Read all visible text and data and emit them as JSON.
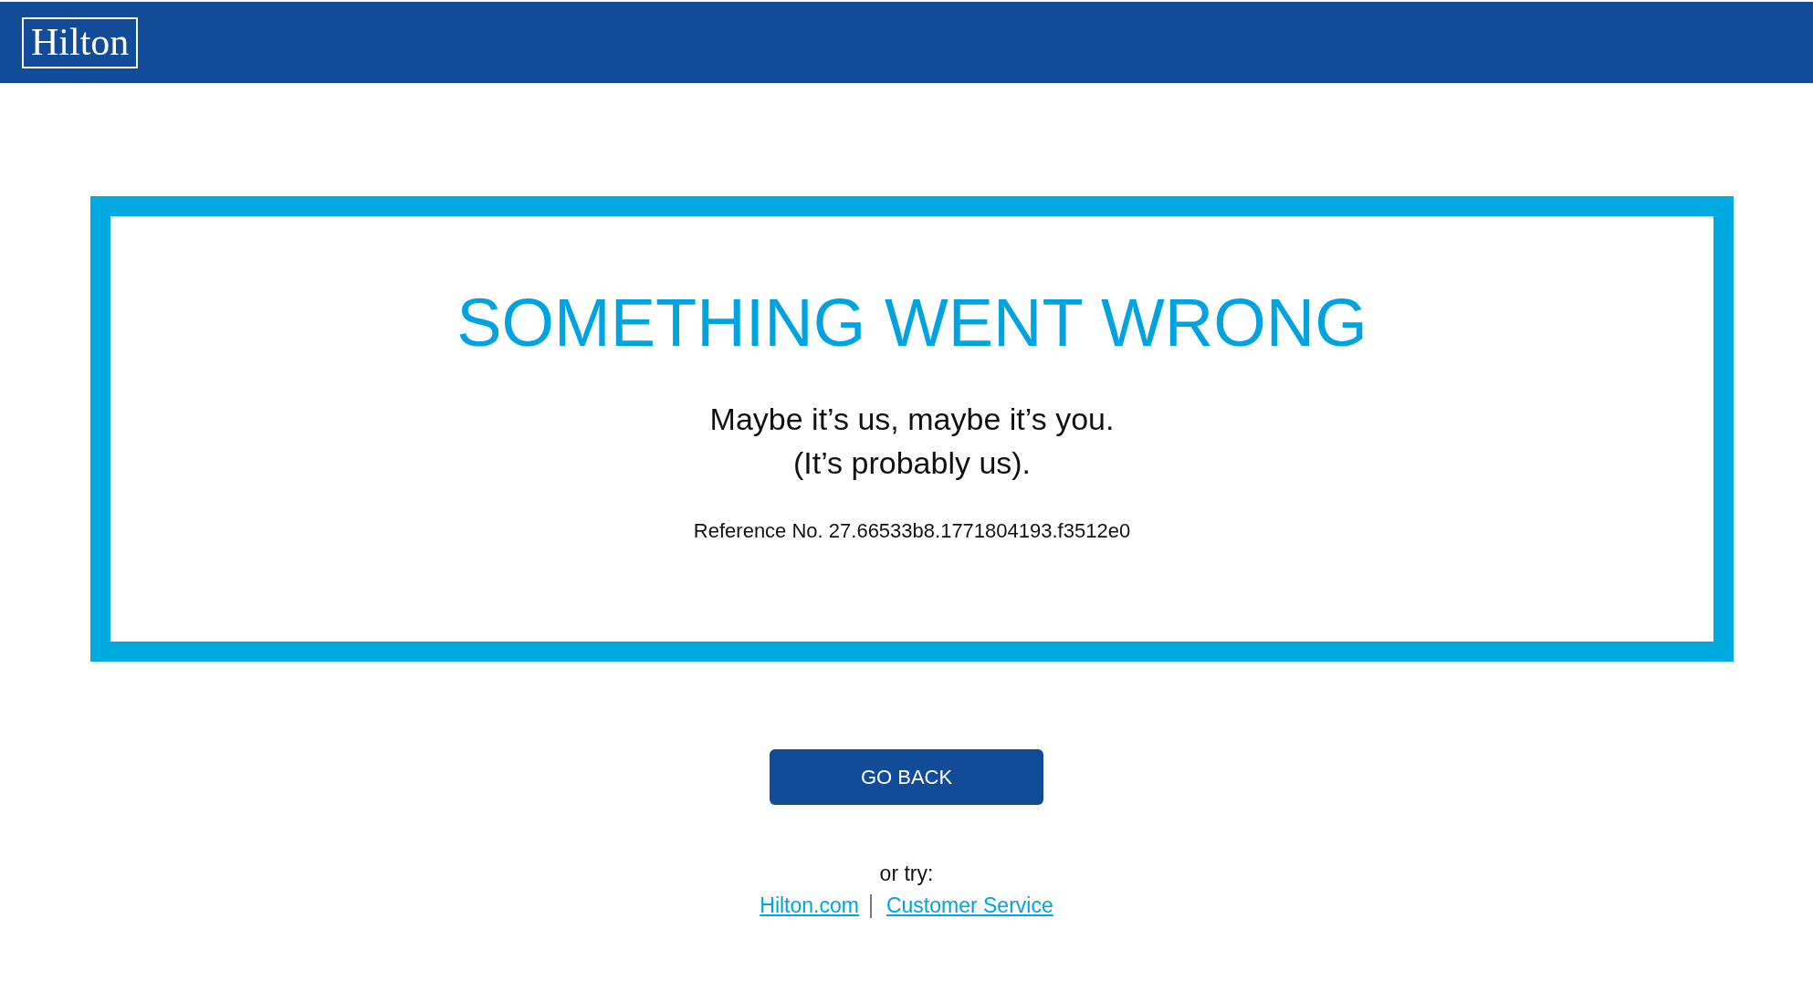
{
  "header": {
    "logo": "Hilton"
  },
  "error_panel": {
    "title": "SOMETHING WENT WRONG",
    "message_lines": [
      "Maybe it’s us, maybe it’s you.",
      "(It’s probably us)."
    ],
    "reference": "Reference No. 27.66533b8.1771804193.f3512e0"
  },
  "button": "GO BACK",
  "alternatives": {
    "label": "or try:",
    "links": [
      "Hilton.com",
      "Customer Service"
    ]
  }
}
